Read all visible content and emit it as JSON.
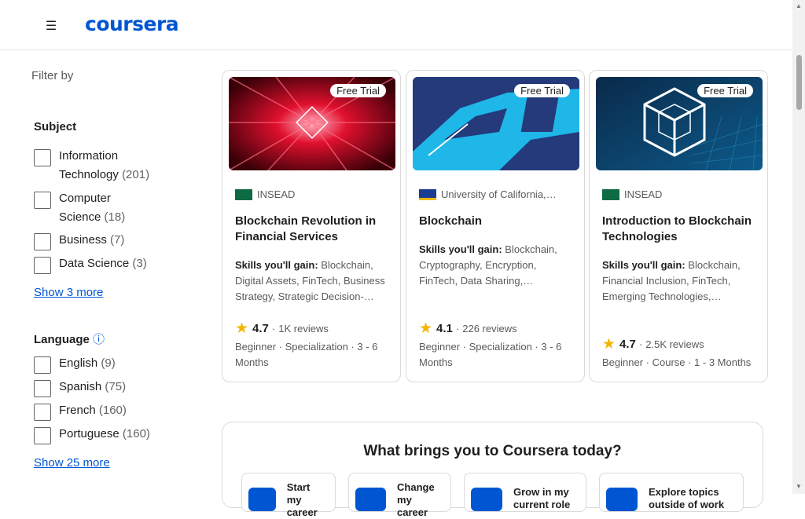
{
  "header": {
    "logo": "coursera"
  },
  "filters": {
    "filter_by": "Filter by",
    "subject": {
      "title": "Subject",
      "items": [
        {
          "line1": "Information",
          "line2": "Technology",
          "count": "(201)"
        },
        {
          "line1": "Computer",
          "line2": "Science",
          "count": "(18)"
        },
        {
          "label": "Business",
          "count": "(7)"
        },
        {
          "label": "Data Science",
          "count": "(3)"
        }
      ],
      "show_more": "Show 3 more"
    },
    "language": {
      "title": "Language",
      "info": "ⓘ",
      "items": [
        {
          "label": "English",
          "count": "(9)"
        },
        {
          "label": "Spanish",
          "count": "(75)"
        },
        {
          "label": "French",
          "count": "(160)"
        },
        {
          "label": "Portuguese",
          "count": "(160)"
        }
      ],
      "show_more": "Show 25 more"
    }
  },
  "cards": [
    {
      "badge": "Free Trial",
      "partner": "INSEAD",
      "title": "Blockchain Revolution in Financial Services",
      "skills_label": "Skills you'll gain:",
      "skills": "Blockchain, Digital Assets, FinTech, Business Strategy, Strategic Decision-…",
      "rating": "4.7",
      "reviews": "1K reviews",
      "meta": "Beginner · Specialization · 3 - 6 Months"
    },
    {
      "badge": "Free Trial",
      "partner": "University of California,…",
      "title": "Blockchain",
      "skills_label": "Skills you'll gain:",
      "skills": "Blockchain, Cryptography, Encryption, FinTech, Data Sharing,…",
      "rating": "4.1",
      "reviews": "226 reviews",
      "meta": "Beginner · Specialization · 3 - 6 Months"
    },
    {
      "badge": "Free Trial",
      "partner": "INSEAD",
      "title": "Introduction to Blockchain Technologies",
      "skills_label": "Skills you'll gain:",
      "skills": "Blockchain, Financial Inclusion, FinTech, Emerging Technologies,…",
      "rating": "4.7",
      "reviews": "2.5K reviews",
      "meta": "Beginner · Course · 1 - 3 Months"
    }
  ],
  "brings": {
    "title": "What brings you to Coursera today?",
    "goals": [
      {
        "line1": "Start",
        "line2": "my career"
      },
      {
        "line1": "Change",
        "line2": "my career"
      },
      {
        "line1": "Grow in my",
        "line2": "current role"
      },
      {
        "line1": "Explore topics",
        "line2": "outside of work"
      }
    ]
  },
  "colors": {
    "brand": "#0056d2",
    "star": "#f2b600"
  },
  "icons": {
    "menu": "hamburger-menu-icon",
    "star": "star-icon",
    "info": "info-icon"
  }
}
